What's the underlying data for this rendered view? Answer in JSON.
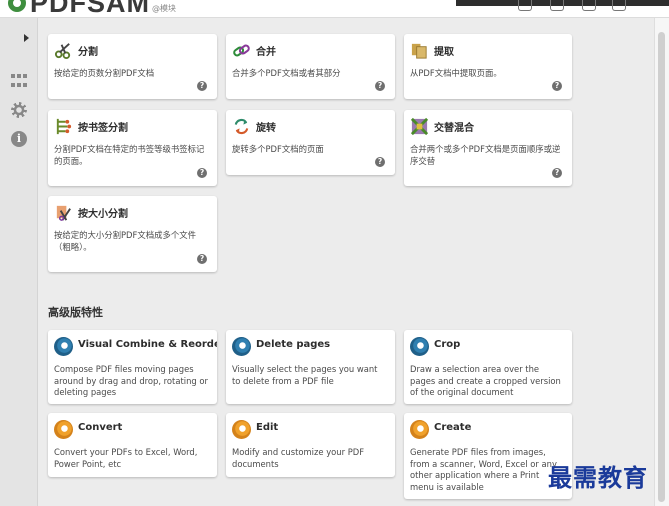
{
  "app": {
    "logo_text": "PDFSAM",
    "logo_sub": "@模块"
  },
  "colors": {
    "accent_blue": "#2f7fb0",
    "accent_orange": "#f0a12b",
    "watermark": "#1a3a9a"
  },
  "sidebar": {
    "icons": [
      "expand-arrow-icon",
      "dashboard-grid-icon",
      "settings-gear-icon",
      "info-icon"
    ]
  },
  "modules": [
    {
      "title": "分割",
      "desc": "按给定的页数分割PDF文档",
      "icon": "scissors-icon"
    },
    {
      "title": "合并",
      "desc": "合并多个PDF文档或者其部分",
      "icon": "chain-link-icon"
    },
    {
      "title": "提取",
      "desc": "从PDF文档中提取页面。",
      "icon": "extract-icon"
    },
    {
      "title": "按书签分割",
      "desc": "分割PDF文档在特定的书签等级书签标记的页面。",
      "icon": "bookmark-split-icon"
    },
    {
      "title": "旋转",
      "desc": "旋转多个PDF文档的页面",
      "icon": "rotate-icon"
    },
    {
      "title": "交替混合",
      "desc": "合并两个或多个PDF文档是页面顺序或逆序交替",
      "icon": "alternate-mix-icon"
    },
    {
      "title": "按大小分割",
      "desc": "按给定的大小分割PDF文档成多个文件（粗略）。",
      "icon": "size-split-icon"
    }
  ],
  "premium_section_title": "高级版特性",
  "premium": [
    {
      "title": "Visual Combine & Reorder",
      "desc": "Compose PDF files moving pages around by drag and drop, rotating or deleting pages",
      "icon": "pdfsam-blue-icon"
    },
    {
      "title": "Delete pages",
      "desc": "Visually select the pages you want to delete from a PDF file",
      "icon": "pdfsam-blue-icon"
    },
    {
      "title": "Crop",
      "desc": "Draw a selection area over the pages and create a cropped version of the original document",
      "icon": "pdfsam-blue-icon"
    },
    {
      "title": "Convert",
      "desc": "Convert your PDFs to Excel, Word, Power Point, etc",
      "icon": "pdfsam-orange-icon"
    },
    {
      "title": "Edit",
      "desc": "Modify and customize your PDF documents",
      "icon": "pdfsam-orange-icon"
    },
    {
      "title": "Create",
      "desc": "Generate PDF files from images, from a scanner, Word, Excel or any other application where a Print menu is available",
      "icon": "pdfsam-orange-icon"
    }
  ],
  "help_glyph": "?",
  "info_glyph": "i",
  "watermark_text": "最需教育"
}
